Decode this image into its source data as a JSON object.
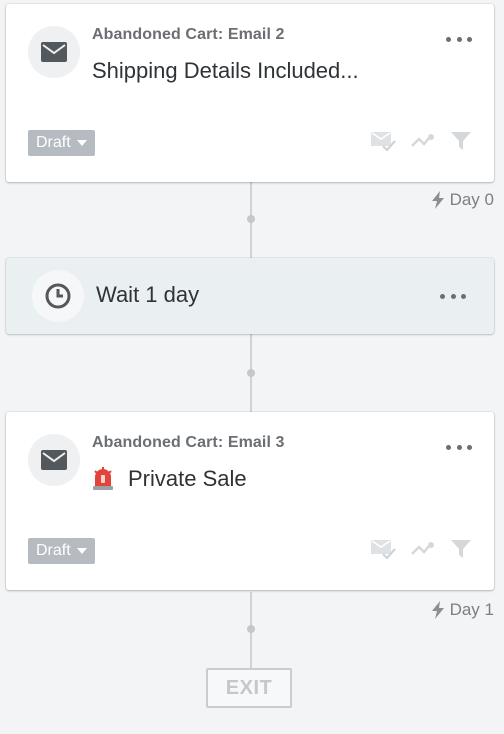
{
  "flow": {
    "email_step_1": {
      "label": "Abandoned Cart: Email 2",
      "title": "Shipping Details Included...",
      "status": "Draft",
      "icon": "envelope-icon"
    },
    "delay_1": {
      "label": "Day 0",
      "icon": "lightning-icon"
    },
    "wait_step": {
      "title": "Wait 1 day",
      "icon": "clock-icon"
    },
    "email_step_2": {
      "label": "Abandoned Cart: Email 3",
      "title": "Private Sale",
      "emoji": "🚨",
      "status": "Draft",
      "icon": "envelope-icon"
    },
    "delay_2": {
      "label": "Day 1",
      "icon": "lightning-icon"
    },
    "exit": {
      "label": "EXIT"
    }
  },
  "colors": {
    "badge_bg": "#b5bbc0",
    "wait_bg": "#eaf0f1",
    "connector": "#cfd3d6",
    "text_dark": "#2f3336",
    "text_muted": "#6b6f73"
  }
}
